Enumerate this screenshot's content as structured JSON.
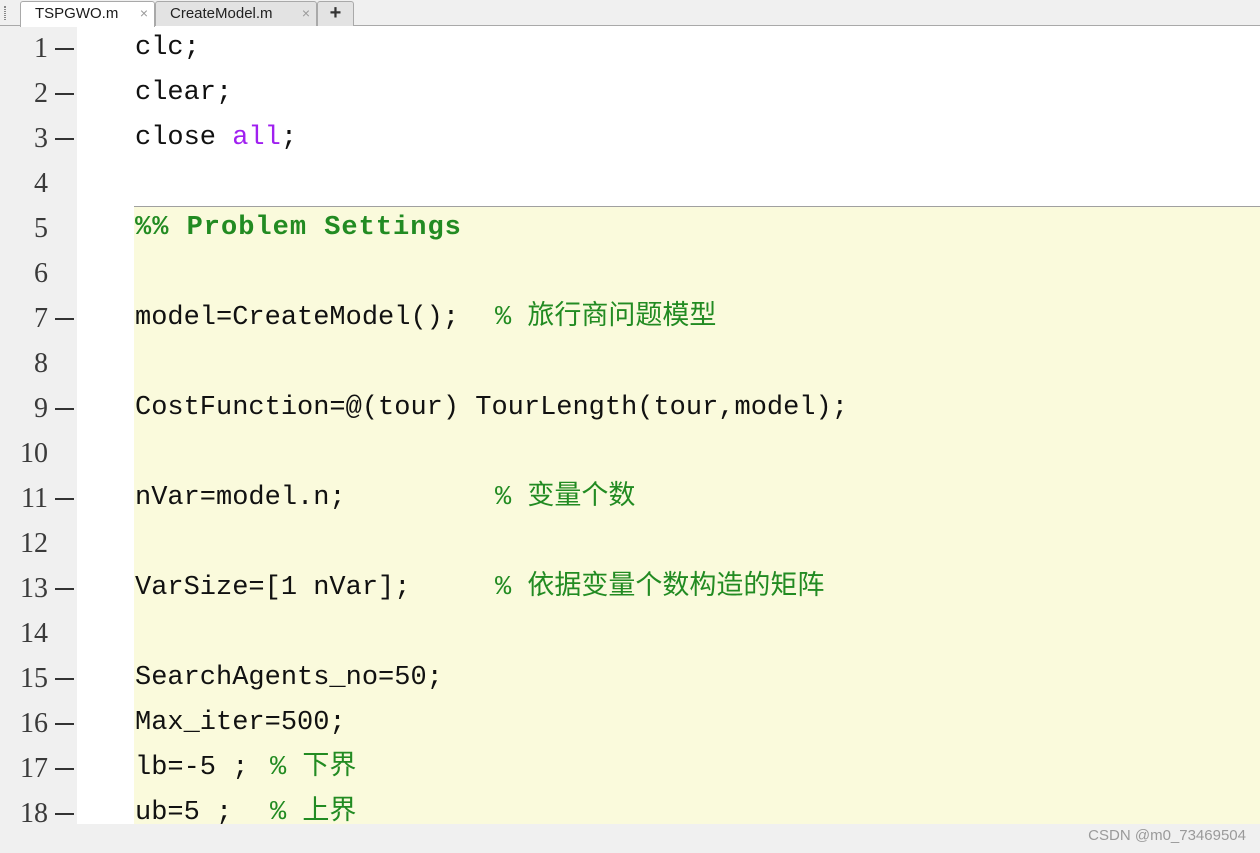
{
  "tabs": [
    {
      "label": "TSPGWO.m",
      "close_icon": "×"
    },
    {
      "label": "CreateModel.m",
      "close_icon": "×"
    }
  ],
  "add_tab_label": "+",
  "lines": [
    {
      "num": "1",
      "code": "clc;"
    },
    {
      "num": "2",
      "code": "clear;"
    },
    {
      "num": "3",
      "code_pre": "close ",
      "code_kw": "all",
      "code_post": ";"
    },
    {
      "num": "4"
    },
    {
      "num": "5",
      "cell_title": "%% Problem Settings"
    },
    {
      "num": "6"
    },
    {
      "num": "7",
      "code": "model=CreateModel();",
      "comment": "% 旅行商问题模型"
    },
    {
      "num": "8"
    },
    {
      "num": "9",
      "code": "CostFunction=@(tour) TourLength(tour,model);"
    },
    {
      "num": "10"
    },
    {
      "num": "11",
      "code": "nVar=model.n;",
      "comment": "% 变量个数"
    },
    {
      "num": "12"
    },
    {
      "num": "13",
      "code": "VarSize=[1 nVar];",
      "comment": "% 依据变量个数构造的矩阵"
    },
    {
      "num": "14"
    },
    {
      "num": "15",
      "code": "SearchAgents_no=50;"
    },
    {
      "num": "16",
      "code": "Max_iter=500;"
    },
    {
      "num": "17",
      "code": "lb=-5 ;",
      "comment": "% 下界"
    },
    {
      "num": "18",
      "code": "ub=5 ;",
      "comment": "% 上界"
    }
  ],
  "watermark": "CSDN @m0_73469504",
  "colors": {
    "comment": "#228b22",
    "string_keyword": "#a020f0",
    "cell_background": "#fafadc",
    "gutter": "#f0f0f0"
  }
}
